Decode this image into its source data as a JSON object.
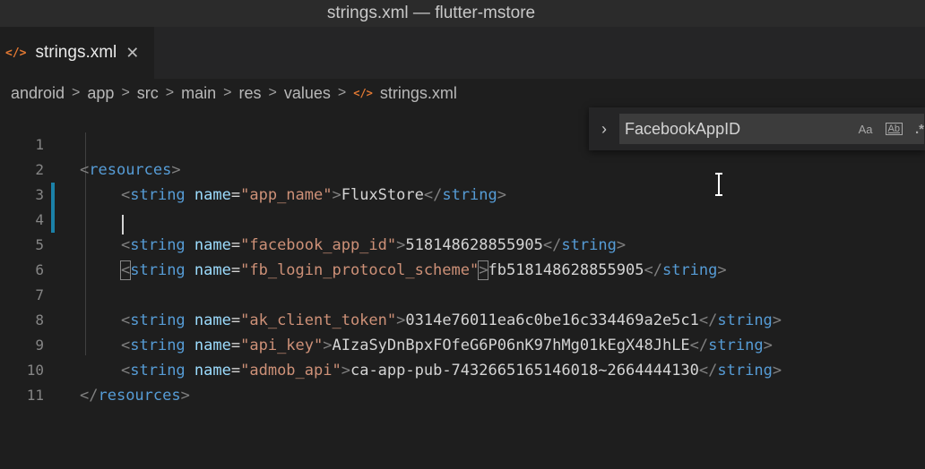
{
  "window": {
    "title": "strings.xml — flutter-mstore"
  },
  "tab": {
    "icon": "xml-file-icon",
    "label": "strings.xml"
  },
  "breadcrumb": {
    "items": [
      "android",
      "app",
      "src",
      "main",
      "res",
      "values"
    ],
    "file": "strings.xml"
  },
  "find": {
    "value": "FacebookAppID",
    "match_case": "Aa",
    "whole_word": "Ab",
    "regex": ".*"
  },
  "line_numbers": [
    "1",
    "2",
    "3",
    "4",
    "5",
    "6",
    "7",
    "8",
    "9",
    "10",
    "11"
  ],
  "code": {
    "l1": {
      "open": "<",
      "tag": "resources",
      "close": ">"
    },
    "l2": {
      "tag": "string",
      "attr": "name",
      "val": "\"app_name\"",
      "text": "FluxStore",
      "end_tag": "string"
    },
    "l4": {
      "tag": "string",
      "attr": "name",
      "val": "\"facebook_app_id\"",
      "text": "518148628855905",
      "end_tag": "string"
    },
    "l5": {
      "tag": "string",
      "attr": "name",
      "val": "\"fb_login_protocol_scheme\"",
      "text": "fb518148628855905",
      "end_tag": "string"
    },
    "l7": {
      "tag": "string",
      "attr": "name",
      "val": "\"ak_client_token\"",
      "text": "0314e76011ea6c0be16c334469a2e5c1",
      "end_tag": "string"
    },
    "l8": {
      "tag": "string",
      "attr": "name",
      "val": "\"api_key\"",
      "text": "AIzaSyDnBpxFOfeG6P06nK97hMg01kEgX48JhLE",
      "end_tag": "string"
    },
    "l9": {
      "tag": "string",
      "attr": "name",
      "val": "\"admob_api\"",
      "text": "ca-app-pub-7432665165146018~2664444130",
      "end_tag": "string"
    },
    "l10": {
      "tag": "resources"
    }
  },
  "colors": {
    "tag": "#569cd6",
    "attr": "#9cdcfe",
    "string": "#ce9178",
    "modified": "#1b81a8"
  }
}
